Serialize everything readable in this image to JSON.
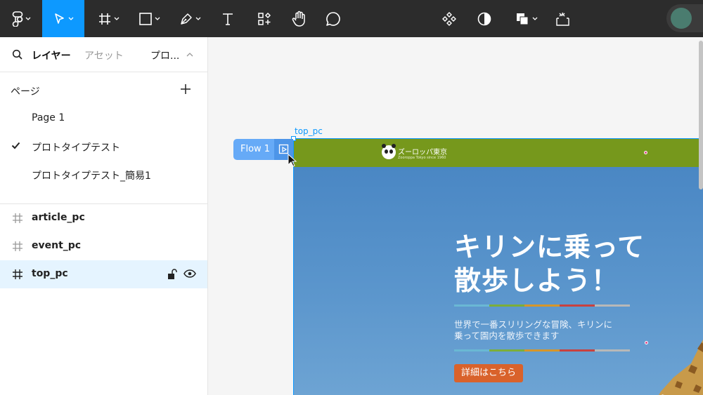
{
  "toolbar": {
    "tools": [
      "main-menu",
      "move",
      "frame",
      "shape",
      "pen",
      "text",
      "resources",
      "hand",
      "comment"
    ],
    "center_tools": [
      "components",
      "contrast",
      "boolean",
      "dev-mode"
    ],
    "active_color": "#0d99ff"
  },
  "panel": {
    "tabs": {
      "layers": "レイヤー",
      "assets": "アセット",
      "prototype": "プロ..."
    },
    "pages_title": "ページ",
    "pages": [
      {
        "label": "Page 1",
        "selected": false
      },
      {
        "label": "プロトタイプテスト",
        "selected": true
      },
      {
        "label": "プロトタイプテスト_簡易1",
        "selected": false
      }
    ],
    "layers": [
      {
        "label": "article_pc",
        "selected": false
      },
      {
        "label": "event_pc",
        "selected": false
      },
      {
        "label": "top_pc",
        "selected": true
      }
    ]
  },
  "canvas": {
    "frame_label": "top_pc",
    "flow_label": "Flow 1",
    "site": {
      "logo_name": "ズーロッパ東京",
      "logo_sub": "Zooroppa Tokyo since 1960",
      "header_color": "#76981c",
      "hero_title_line1": "キリンに乗って",
      "hero_title_line2": "散歩しよう！",
      "hero_desc_line1": "世界で一番スリリングな冒険、キリンに",
      "hero_desc_line2": "乗って園内を散歩できます",
      "cta_label": "詳細はこちら",
      "cta_color": "#d9622b",
      "stripe_colors": [
        "#6ab8d4",
        "#7cae3a",
        "#d6962a",
        "#c8413f",
        "#b8b8b8"
      ]
    }
  }
}
